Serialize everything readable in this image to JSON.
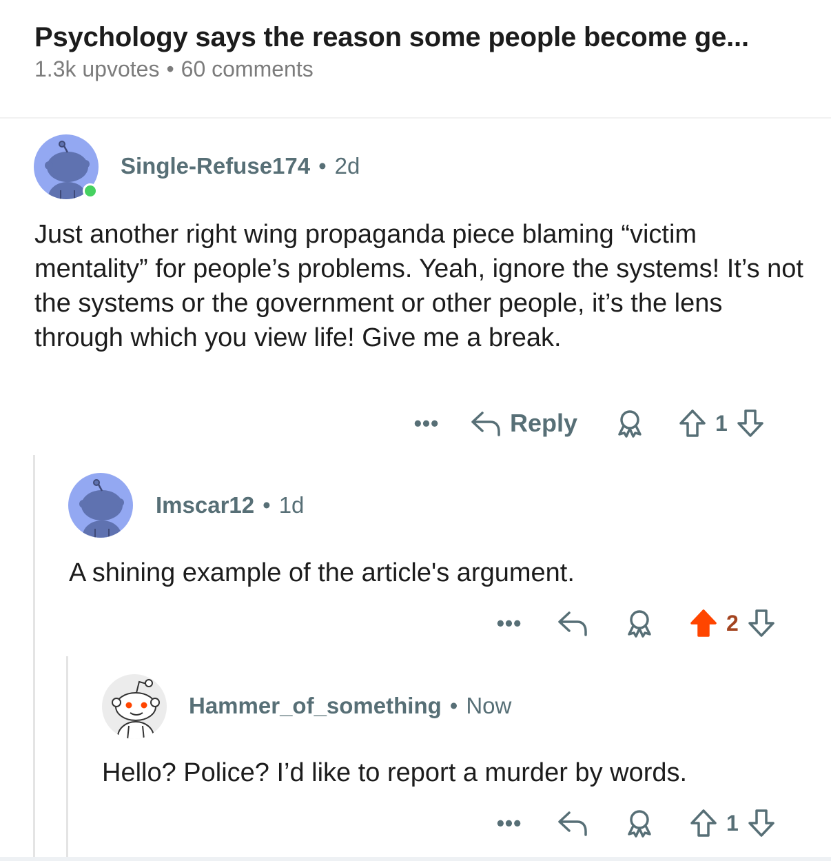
{
  "post": {
    "title": "Psychology says the reason some people become ge...",
    "upvotes": "1.3k upvotes",
    "separator": "•",
    "comments": "60 comments"
  },
  "comments": [
    {
      "username": "Single-Refuse174",
      "separator": "•",
      "age": "2d",
      "online": true,
      "body": "Just another right wing propaganda piece blaming “victim mentality” for people’s problems. Yeah, ignore the systems! It’s not the systems or the government or other people, it’s the lens through which you view life! Give me a break.",
      "more_label": "•••",
      "reply_label": "Reply",
      "score": "1",
      "upvoted": false
    },
    {
      "username": "Imscar12",
      "separator": "•",
      "age": "1d",
      "online": false,
      "body": "A shining example of the article's argument.",
      "more_label": "•••",
      "score": "2",
      "upvoted": true
    },
    {
      "username": "Hammer_of_something",
      "separator": "•",
      "age": "Now",
      "online": false,
      "body": "Hello? Police? I’d like to report a murder by words.",
      "more_label": "•••",
      "score": "1",
      "upvoted": false
    }
  ],
  "colors": {
    "upvote_active": "#ff4500",
    "vote_count_active": "#a34420",
    "meta_gray": "#576f76",
    "avatar_blue": "#93a8f2",
    "avatar_body": "#5f72b0",
    "online_green": "#46d160"
  },
  "icons": {
    "reply": "reply-arrow-icon",
    "award": "award-icon",
    "upvote": "upvote-arrow-icon",
    "downvote": "downvote-arrow-icon",
    "more": "more-dots-icon"
  }
}
